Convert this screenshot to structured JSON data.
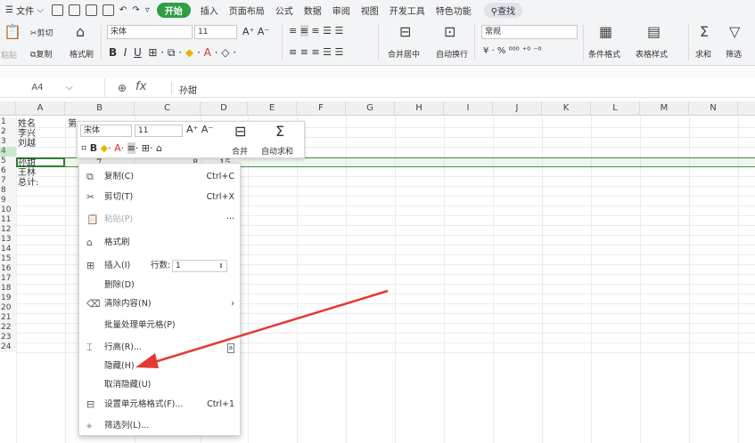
{
  "menubar": {
    "file": "文件",
    "tabs": [
      "插入",
      "页面布局",
      "公式",
      "数据",
      "审阅",
      "视图",
      "开发工具",
      "特色功能"
    ],
    "active_tab": "开始",
    "search": "查找"
  },
  "ribbon": {
    "paste": "粘贴",
    "cut": "剪切",
    "copy": "复制",
    "format_painter": "格式刷",
    "font_name": "宋体",
    "font_size": "11",
    "merge_center": "合并居中",
    "wrap_text": "自动换行",
    "number_format": "常规",
    "conditional_format": "条件格式",
    "table_style": "表格样式",
    "sum": "求和",
    "filter": "筛选"
  },
  "formula_bar": {
    "name_box": "A4",
    "fx": "fx",
    "value": "孙甜"
  },
  "columns": [
    "A",
    "B",
    "C",
    "D",
    "E",
    "F",
    "G",
    "H",
    "I",
    "J",
    "K",
    "L",
    "M",
    "N"
  ],
  "rows": [
    "1",
    "2",
    "3",
    "4",
    "5",
    "6",
    "7",
    "8",
    "9",
    "10",
    "11",
    "12",
    "13",
    "14",
    "15",
    "16",
    "17",
    "18",
    "19",
    "20",
    "21",
    "22",
    "23",
    "24"
  ],
  "cells": {
    "a1": "姓名",
    "a2": "李兴",
    "a3": "刘越",
    "a4": "孙甜",
    "a5": "王林",
    "a6": "总计:",
    "b1": "第一",
    "b4": "7",
    "c4": "8",
    "d4": "15"
  },
  "mini_toolbar": {
    "font": "宋体",
    "size": "11",
    "merge": "合并",
    "autosum": "自动求和"
  },
  "context_menu": {
    "copy": "复制(C)",
    "copy_sc": "Ctrl+C",
    "cut": "剪切(T)",
    "cut_sc": "Ctrl+X",
    "paste": "粘贴(P)",
    "paste_more": "···",
    "format_painter": "格式刷",
    "insert": "插入(I)",
    "rows_label": "行数:",
    "rows_value": "1",
    "delete": "删除(D)",
    "clear": "清除内容(N)",
    "batch": "批量处理单元格(P)",
    "row_height": "行高(R)...",
    "hide": "隐藏(H)",
    "unhide": "取消隐藏(U)",
    "format_cells": "设置单元格格式(F)...",
    "format_cells_sc": "Ctrl+1",
    "filter": "筛选列(L)..."
  },
  "colors": {
    "accent": "#2f9e44",
    "arrow": "#e53935"
  }
}
